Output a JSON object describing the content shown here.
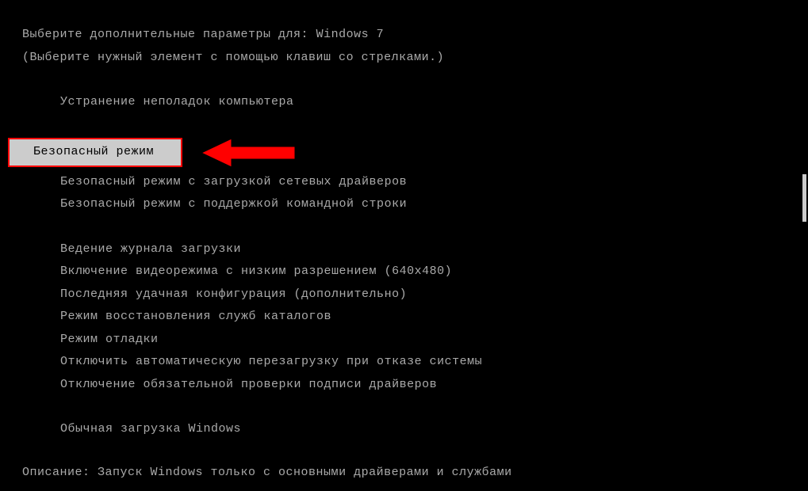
{
  "header": {
    "title_prefix": "Выберите дополнительные параметры для: ",
    "os_name": "Windows 7",
    "instruction": "(Выберите нужный элемент с помощью клавиш со стрелками.)"
  },
  "menu": {
    "repair": "Устранение неполадок компьютера",
    "safe_mode": "Безопасный режим",
    "safe_mode_net": "Безопасный режим с загрузкой сетевых драйверов",
    "safe_mode_cmd": "Безопасный режим с поддержкой командной строки",
    "boot_log": "Ведение журнала загрузки",
    "low_res": "Включение видеорежима с низким разрешением (640x480)",
    "last_known": "Последняя удачная конфигурация (дополнительно)",
    "ds_restore": "Режим восстановления служб каталогов",
    "debug": "Режим отладки",
    "no_auto_restart": "Отключить автоматическую перезагрузку при отказе системы",
    "no_driver_sig": "Отключение обязательной проверки подписи драйверов",
    "normal": "Обычная загрузка Windows"
  },
  "footer": {
    "desc_label": "Описание: ",
    "desc_text": "Запуск Windows только с основными драйверами и службами"
  }
}
